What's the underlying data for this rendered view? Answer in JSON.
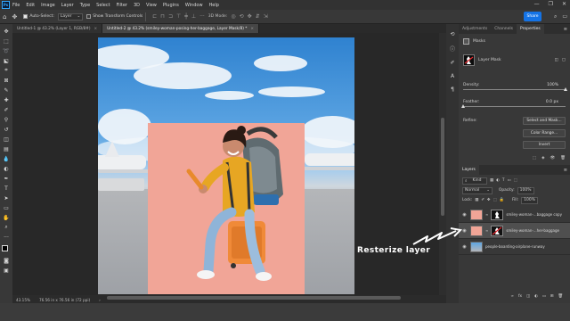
{
  "menubar": {
    "logo": "Ps",
    "items": [
      "File",
      "Edit",
      "Image",
      "Layer",
      "Type",
      "Select",
      "Filter",
      "3D",
      "View",
      "Plugins",
      "Window",
      "Help"
    ],
    "window_controls": [
      "—",
      "❐",
      "✕"
    ]
  },
  "options": {
    "auto_select_label": "Auto-Select:",
    "auto_select_value": "Layer",
    "show_transform_label": "Show Transform Controls",
    "mode_3d_label": "3D Mode:",
    "share_label": "Share"
  },
  "tabs": [
    {
      "label": "Untitled-1 @ 43.2% (Layer 1, RGB/8#)",
      "close": "×"
    },
    {
      "label": "Untitled-2 @ 43.2% (smiley-woman-posing-her-baggage, Layer Mask/8) *",
      "close": "×"
    }
  ],
  "status": {
    "zoom": "43.15%",
    "doc_size": "76.56 in x 76.56 in (72 ppi)"
  },
  "properties": {
    "tabs": [
      "Adjustments",
      "Channels",
      "Properties"
    ],
    "active_tab": "Properties",
    "masks_label": "Masks",
    "layer_mask_label": "Layer Mask",
    "density_label": "Density:",
    "density_value": "100%",
    "density": 1.0,
    "feather_label": "Feather:",
    "feather_value": "0.0 px",
    "feather": 0.0,
    "refine_label": "Refine:",
    "select_mask_label": "Select and Mask...",
    "color_range_label": "Color Range...",
    "invert_label": "Invert"
  },
  "layers": {
    "title": "Layers",
    "filter_label": "Kind",
    "blend_mode": "Normal",
    "opacity_label": "Opacity:",
    "opacity_value": "100%",
    "lock_label": "Lock:",
    "fill_label": "Fill:",
    "fill_value": "100%",
    "items": [
      {
        "name": "smiley-woman-...baggage copy",
        "selected": false
      },
      {
        "name": "smiley-woman-...her-baggage",
        "selected": true
      },
      {
        "name": "people-boarding-airplane-runway",
        "selected": false
      }
    ]
  },
  "annotation": "Resterize layer",
  "colors": {
    "accent": "#1473e6",
    "pink_bg": "#f1a597",
    "panel": "#383838"
  }
}
